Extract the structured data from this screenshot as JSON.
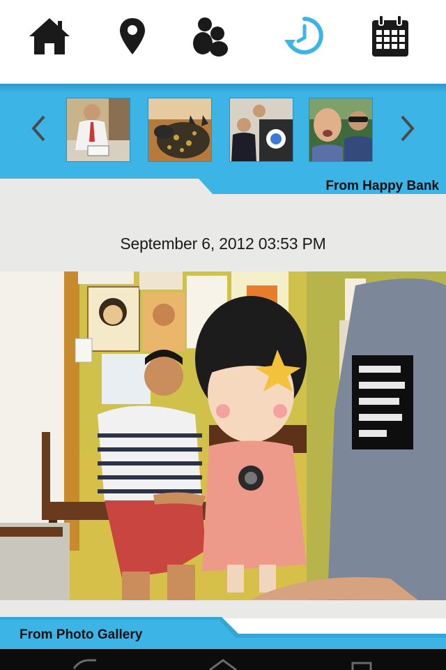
{
  "nav": {
    "items": [
      {
        "icon": "home-icon",
        "label": ""
      },
      {
        "icon": "location-pin-icon",
        "label": ""
      },
      {
        "icon": "people-icon",
        "label": ""
      },
      {
        "icon": "history-clock-icon",
        "label": "",
        "active": true
      },
      {
        "icon": "calendar-icon",
        "label": ""
      }
    ],
    "icon_color": "#1a1a1a",
    "active_color": "#3cb4e6"
  },
  "carousel": {
    "thumbnails": [
      {
        "name": "thumb-man-red-tie"
      },
      {
        "name": "thumb-dog-blanket"
      },
      {
        "name": "thumb-two-men-booth"
      },
      {
        "name": "thumb-selfie-sunglasses"
      }
    ]
  },
  "labels": {
    "source_top": "From Happy Bank",
    "source_bottom": "From Photo Gallery"
  },
  "post": {
    "timestamp": "September 6, 2012  03:53 PM"
  },
  "colors": {
    "accent_blue": "#3cb4e6",
    "content_bg": "#e9e9e7",
    "system_bar": "#0c0c0c"
  }
}
